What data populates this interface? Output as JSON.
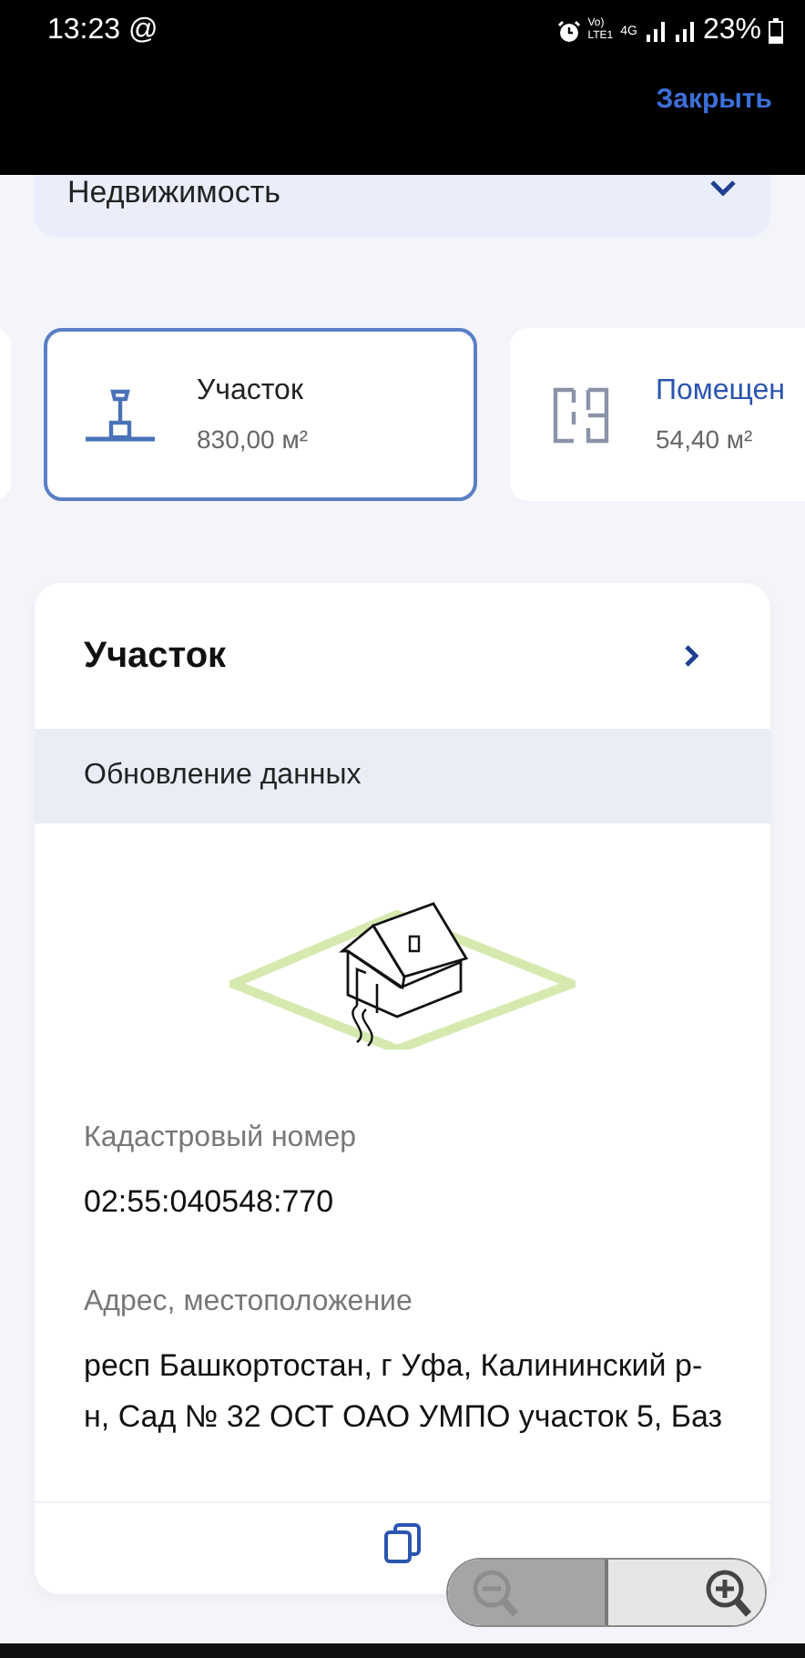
{
  "status_bar": {
    "time": "13:23 @",
    "volte": "Vo)",
    "lte": "LTE1",
    "network": "4G",
    "battery": "23%"
  },
  "header": {
    "close": "Закрыть"
  },
  "category_select": {
    "value": "Недвижимость"
  },
  "objects": [
    {
      "kind": "stub",
      "selected": false
    },
    {
      "kind": "land",
      "title": "Участок",
      "area": "830,00 м²",
      "selected": true
    },
    {
      "kind": "premises",
      "title": "Помещен",
      "area": "54,40 м²",
      "selected": false
    }
  ],
  "detail_card": {
    "title": "Участок",
    "notice": "Обновление данных",
    "fields": [
      {
        "label": "Кадастровый номер",
        "lines": [
          "02:55:040548:770"
        ]
      },
      {
        "label": "Адрес, местоположение",
        "lines": [
          "респ Башкортостан, г Уфа, Калининский р-",
          "н, Сад № 32 ОСТ ОАО УМПО участок 5, Баз"
        ]
      }
    ]
  }
}
